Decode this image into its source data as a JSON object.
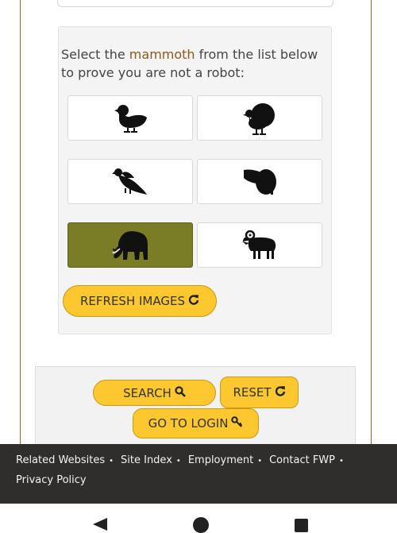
{
  "captcha": {
    "prompt_before": "Select the ",
    "target_animal": "mammoth",
    "prompt_after": " from the list below to prove you are not a robot:",
    "images": [
      {
        "icon": "duck-icon",
        "selected": false
      },
      {
        "icon": "turkey-icon",
        "selected": false
      },
      {
        "icon": "eagle-icon",
        "selected": false
      },
      {
        "icon": "beaver-icon",
        "selected": false
      },
      {
        "icon": "mammoth-icon",
        "selected": true
      },
      {
        "icon": "ram-icon",
        "selected": false
      }
    ],
    "refresh_label": "REFRESH IMAGES",
    "refresh_icon": "refresh-icon"
  },
  "form_actions": {
    "search_label": "SEARCH",
    "search_icon": "search-icon",
    "reset_label": "RESET",
    "reset_icon": "refresh-icon",
    "login_label": "GO TO LOGIN",
    "login_icon": "key-icon"
  },
  "footer": {
    "links": [
      "Related Websites",
      "Site Index",
      "Employment",
      "Contact FWP",
      "Privacy Policy"
    ],
    "separator": "•"
  },
  "colors": {
    "accent_button": "#fcc72f",
    "selected_tile": "#7a7d25",
    "target_text": "#8a5a1c",
    "footer_bg": "#2f2e2c"
  }
}
